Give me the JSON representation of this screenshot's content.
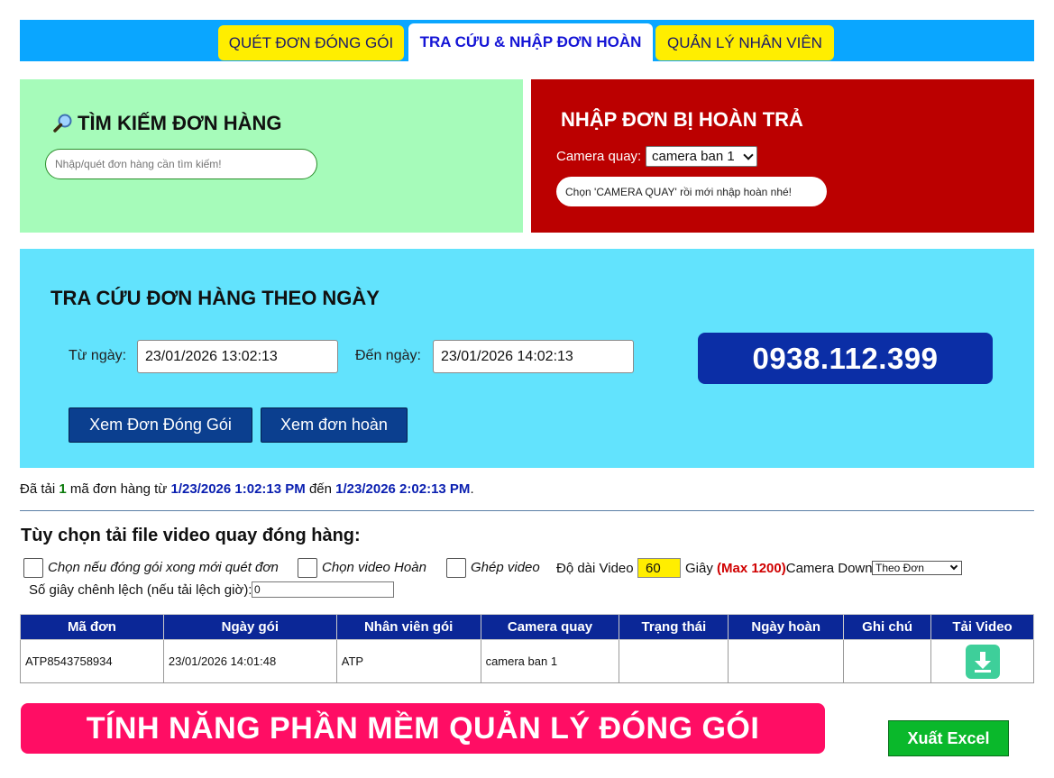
{
  "tabs": [
    {
      "label": "QUÉT ĐƠN ĐÓNG GÓI"
    },
    {
      "label": "TRA CỨU & NHẬP ĐƠN HOÀN"
    },
    {
      "label": "QUẢN LÝ NHÂN VIÊN"
    }
  ],
  "search": {
    "title": "TÌM KIẾM ĐƠN HÀNG",
    "placeholder": "Nhập/quét đơn hàng cần tìm kiếm!"
  },
  "returns": {
    "title": "NHẬP ĐƠN BỊ HOÀN TRẢ",
    "camera_label": "Camera quay:",
    "camera_value": "camera ban 1",
    "hint": "Chọn 'CAMERA QUAY' rồi mới nhập hoàn nhé!"
  },
  "date_lookup": {
    "title": "TRA CỨU ĐƠN HÀNG THEO NGÀY",
    "from_label": "Từ ngày:",
    "from_value": "23/01/2026 13:02:13",
    "to_label": "Đến ngày:",
    "to_value": "23/01/2026 14:02:13",
    "phone": "0938.112.399",
    "btn_packed": "Xem Đơn Đóng Gói",
    "btn_returned": "Xem đơn hoàn"
  },
  "status": {
    "prefix": "Đã tải",
    "count": "1",
    "mid": "mã đơn hàng từ",
    "from": "1/23/2026 1:02:13 PM",
    "to_word": "đến",
    "to": "1/23/2026 2:02:13 PM",
    "suffix": "."
  },
  "video_options": {
    "title": "Tùy chọn tải file video quay đóng hàng:",
    "opt1": "Chọn nếu đóng gói xong mới quét đơn",
    "opt2": "Chọn video Hoàn",
    "opt3": "Ghép video",
    "length_label": "Độ dài Video",
    "length_value": "60",
    "seconds": "Giây",
    "max": "(Max 1200)",
    "camera_down_label": "Camera Down",
    "camera_down_value": "Theo Đơn",
    "offset_label": "Số giây chênh lệch (nếu tải lệch giờ):",
    "offset_value": "0"
  },
  "table": {
    "headers": [
      "Mã đơn",
      "Ngày gói",
      "Nhân viên gói",
      "Camera quay",
      "Trạng thái",
      "Ngày hoàn",
      "Ghi chú",
      "Tải Video"
    ],
    "rows": [
      {
        "code": "ATP8543758934",
        "date": "23/01/2026 14:01:48",
        "staff": "ATP",
        "camera": "camera ban 1",
        "status": "",
        "return_date": "",
        "note": ""
      }
    ]
  },
  "promo": "TÍNH NĂNG PHẦN MỀM QUẢN LÝ ĐÓNG GÓI",
  "export_label": "Xuất Excel",
  "colors": {
    "tabbar": "#0aa6ff",
    "green_panel": "#a6fbba",
    "red_panel": "#bb0000",
    "blue_panel": "#62e3fd",
    "table_header": "#0b2797",
    "promo": "#ff0d64",
    "excel": "#0ab82b"
  }
}
